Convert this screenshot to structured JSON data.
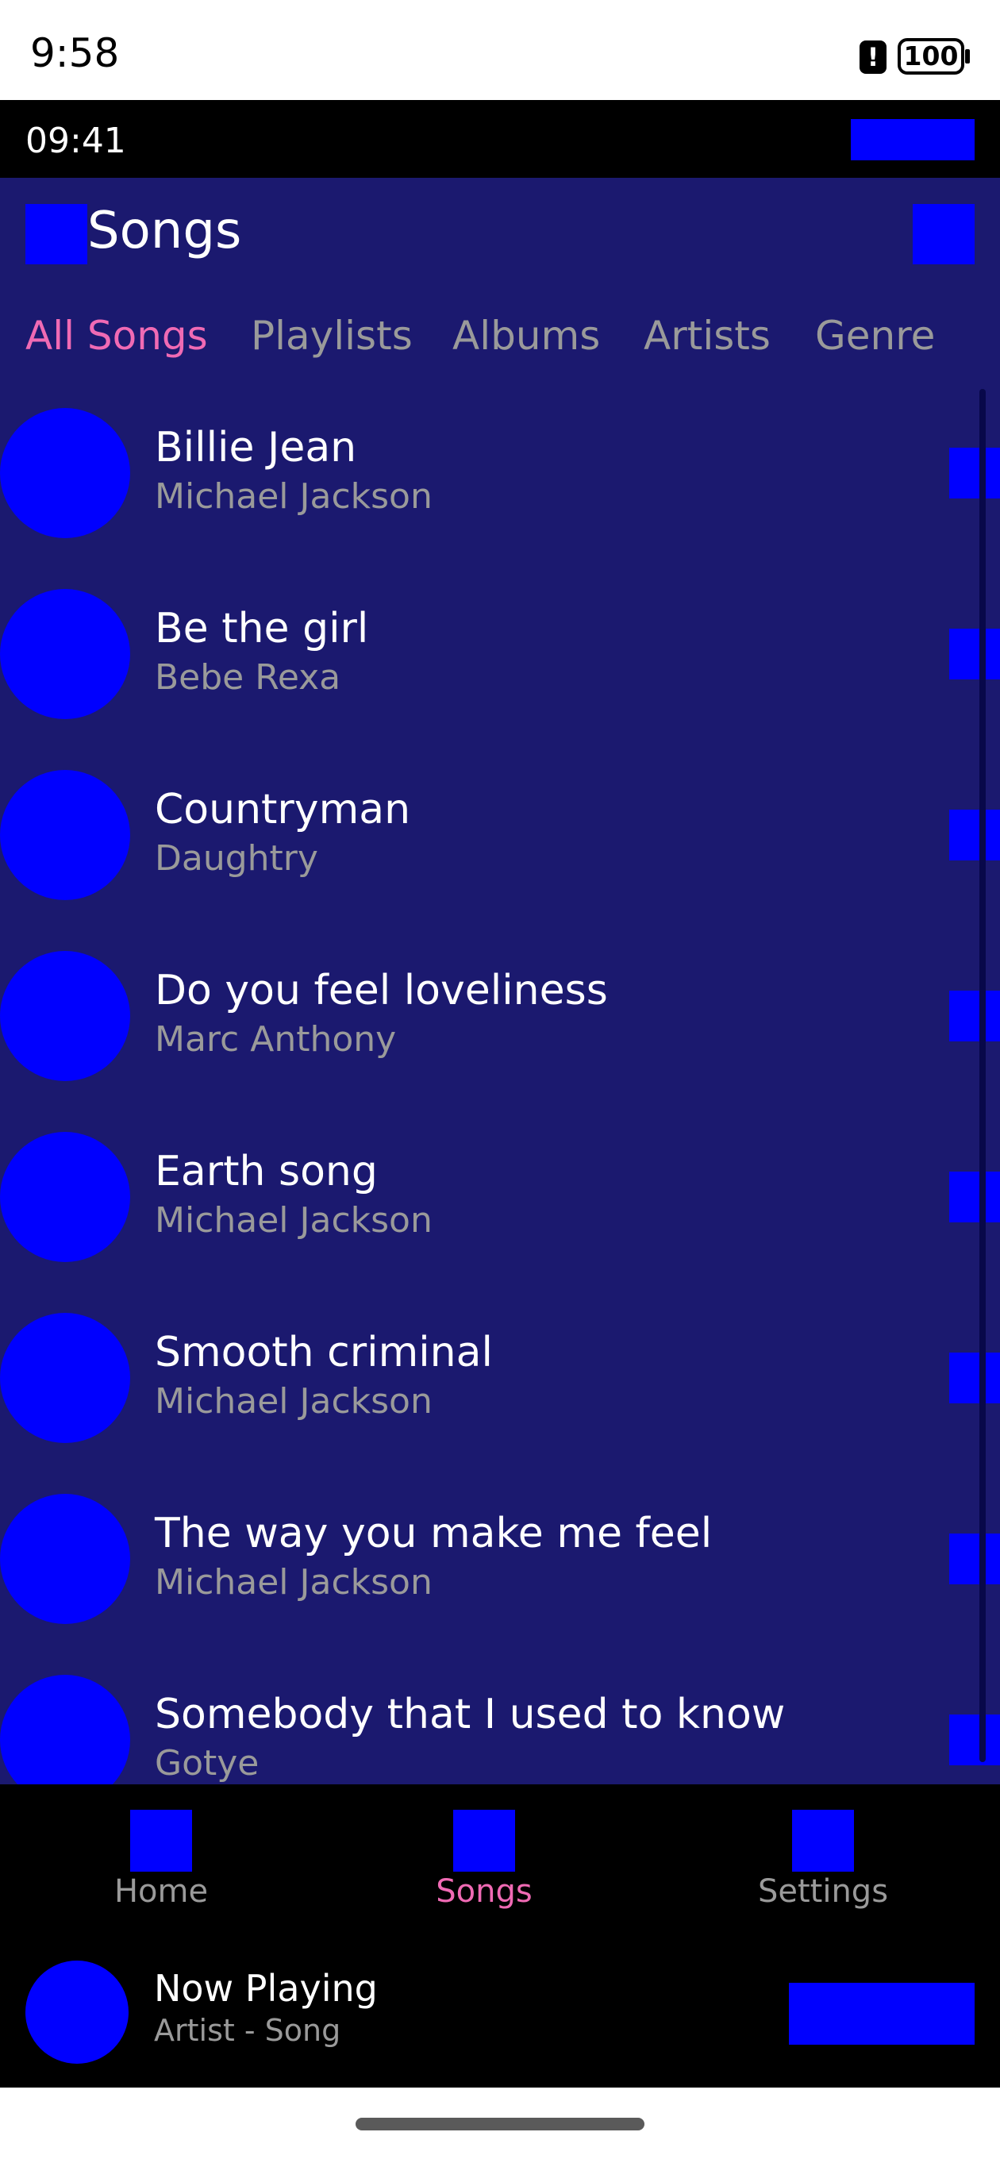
{
  "status_bar": {
    "time": "9:58",
    "alert_glyph": "!",
    "battery": "100"
  },
  "app_bar": {
    "time": "09:41"
  },
  "header": {
    "title": "Songs"
  },
  "tabs": [
    {
      "label": "All Songs",
      "active": true
    },
    {
      "label": "Playlists",
      "active": false
    },
    {
      "label": "Albums",
      "active": false
    },
    {
      "label": "Artists",
      "active": false
    },
    {
      "label": "Genre",
      "active": false
    }
  ],
  "songs": [
    {
      "title": "Billie Jean",
      "artist": "Michael Jackson"
    },
    {
      "title": "Be the girl",
      "artist": "Bebe Rexa"
    },
    {
      "title": "Countryman",
      "artist": "Daughtry"
    },
    {
      "title": "Do you feel loveliness",
      "artist": "Marc Anthony"
    },
    {
      "title": "Earth song",
      "artist": "Michael Jackson"
    },
    {
      "title": "Smooth criminal",
      "artist": "Michael Jackson"
    },
    {
      "title": "The way you make me feel",
      "artist": "Michael Jackson"
    },
    {
      "title": "Somebody that I used to know",
      "artist": "Gotye"
    }
  ],
  "bottom_nav": [
    {
      "label": "Home",
      "active": false
    },
    {
      "label": "Songs",
      "active": true
    },
    {
      "label": "Settings",
      "active": false
    }
  ],
  "now_playing": {
    "title": "Now Playing",
    "subtitle": "Artist - Song"
  },
  "colors": {
    "background": "#1b196f",
    "placeholder": "#0000ff",
    "accent": "#f06ab4",
    "muted_text": "#9a9a9a",
    "bar": "#000000"
  }
}
